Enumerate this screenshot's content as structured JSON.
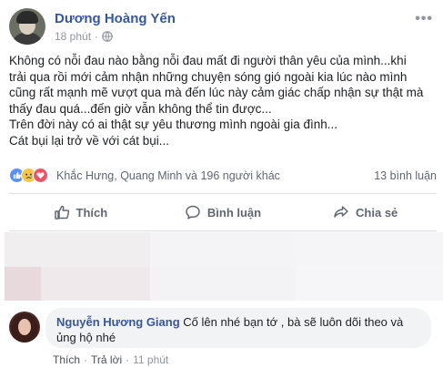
{
  "post": {
    "author": "Dương Hoàng Yến",
    "time": "18 phút",
    "audience_icon": "globe-icon",
    "more_icon": "more-dots-icon",
    "lines": [
      "Không có nỗi đau nào bằng nỗi đau mất đi người thân yêu của mình...khi",
      "trải qua rồi mới cảm nhận những chuyện sóng gió ngoài kia lúc nào mình",
      "cũng rất mạnh mẽ vượt qua mà đến lúc này cảm giác chấp nhận sự thật mà",
      "thấy đau quá...đến giờ vẫn không thể tin được...",
      "Trên đời này có ai thật sự yêu thương mình ngoài gia đình...",
      "Cát bụi lại trở về với cát bụi..."
    ]
  },
  "reactions": {
    "icons": [
      "like-reaction-icon",
      "sad-reaction-icon",
      "love-reaction-icon"
    ],
    "names": "Khắc Hưng, Quang Minh và 196 người khác",
    "comment_count": "13 bình luận"
  },
  "actions": {
    "like": "Thích",
    "comment": "Bình luận",
    "share": "Chia sẻ"
  },
  "comment": {
    "author": "Nguyễn Hương Giang",
    "text": " Cố lên nhé bạn tớ , bà sẽ luôn dõi theo và",
    "text_line2": "ủng hộ nhé",
    "like": "Thích",
    "reply": "Trả lời",
    "time": "11 phút"
  },
  "colors": {
    "link": "#365899",
    "meta": "#90949c",
    "like_reaction": "#5890ff",
    "sad_reaction": "#f7c646",
    "love_reaction": "#f25268"
  }
}
